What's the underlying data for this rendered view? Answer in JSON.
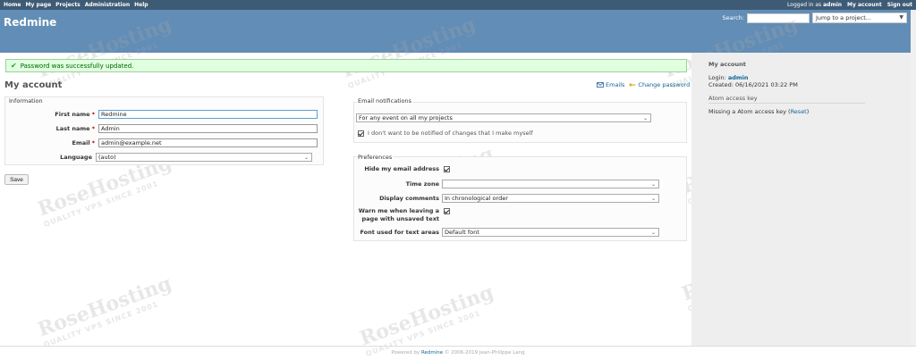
{
  "topmenu": {
    "items": [
      "Home",
      "My page",
      "Projects",
      "Administration",
      "Help"
    ],
    "logged_in_prefix": "Logged in as",
    "user": "admin",
    "my_account": "My account",
    "sign_out": "Sign out"
  },
  "header": {
    "title": "Redmine",
    "search_label": "Search:",
    "search_placeholder": "",
    "jump_placeholder": "Jump to a project..."
  },
  "flash": {
    "message": "Password was successfully updated."
  },
  "page": {
    "title": "My account",
    "emails_link": "Emails",
    "change_password_link": "Change password"
  },
  "information": {
    "legend": "Information",
    "first_name_label": "First name",
    "first_name_value": "Redmine",
    "last_name_label": "Last name",
    "last_name_value": "Admin",
    "email_label": "Email",
    "email_value": "admin@example.net",
    "language_label": "Language",
    "language_value": "(auto)",
    "required_mark": "*"
  },
  "notifications": {
    "legend": "Email notifications",
    "option": "For any event on all my projects",
    "no_self_notified": "I don't want to be notified of changes that I make myself"
  },
  "preferences": {
    "legend": "Preferences",
    "hide_email_label": "Hide my email address",
    "time_zone_label": "Time zone",
    "time_zone_value": "",
    "display_comments_label": "Display comments",
    "display_comments_value": "In chronological order",
    "warn_leaving_label_1": "Warn me when leaving a",
    "warn_leaving_label_2": "page with unsaved text",
    "font_label": "Font used for text areas",
    "font_value": "Default font"
  },
  "save_button": "Save",
  "sidebar": {
    "heading": "My account",
    "login_label": "Login:",
    "login_value": "admin",
    "created": "Created: 06/16/2021 03:22 PM",
    "atom_heading": "Atom access key",
    "atom_missing": "Missing a Atom access key",
    "reset": "Reset"
  },
  "footer": {
    "powered_by": "Powered by",
    "redmine": "Redmine",
    "copyright": "© 2006-2019 Jean-Philippe Lang"
  },
  "watermark": {
    "brand": "RoseHosting",
    "tagline": "QUALITY VPS SINCE 2001"
  },
  "colors": {
    "topmenu": "#3e5b76",
    "header": "#628db6",
    "flash_bg": "#dfffdf",
    "link": "#116699",
    "sidebar": "#eeeeee"
  }
}
